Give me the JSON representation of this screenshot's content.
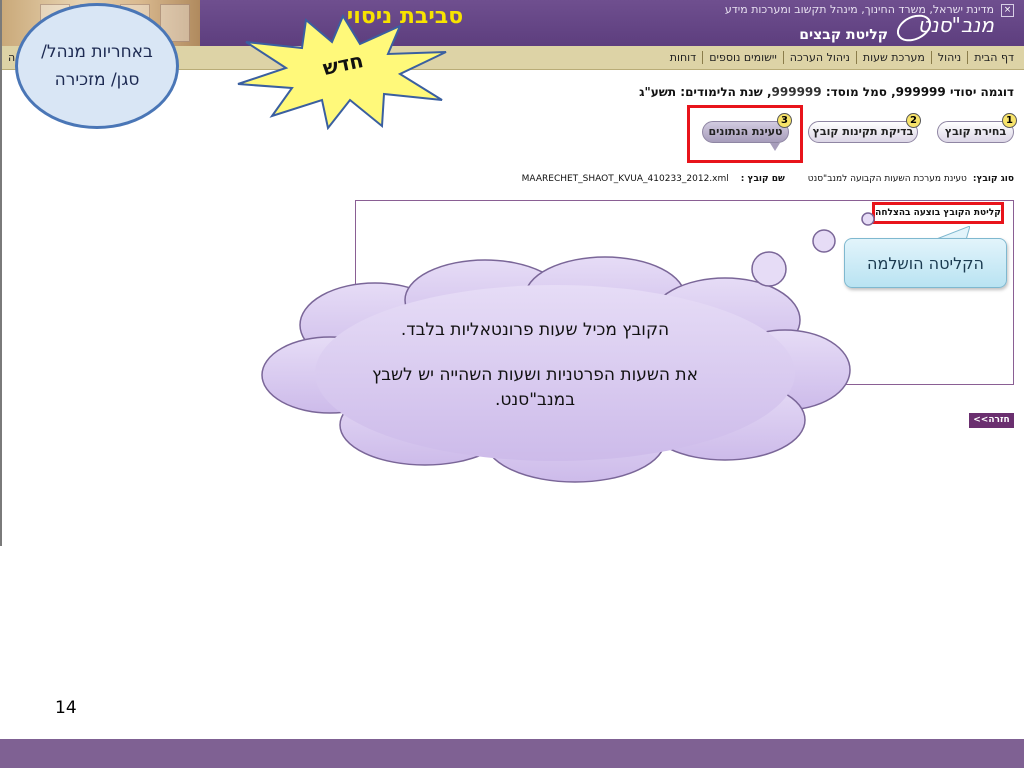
{
  "header": {
    "environment_title": "סביבת ניסוי",
    "ministry_line": "מדינת ישראל, משרד החינוך, מינהל תקשוב ומערכות מידע",
    "brand_name": "מנב\"סנט",
    "page_heading": "קליטת קבצים"
  },
  "menu": {
    "items": [
      "דף הבית",
      "ניהול",
      "מערכת שעות",
      "ניהול הערכה",
      "יישומים נוספים",
      "דוחות"
    ],
    "left_stub": "ה"
  },
  "school": {
    "name_label": "דוגמה יסודי",
    "name_code": "999999",
    "institution_label": "סמל מוסד:",
    "institution_code": "999999",
    "year_label": "שנת הלימודים:",
    "year_value": "תשע\"ג"
  },
  "steps": [
    {
      "num": "1",
      "label": "בחירת קובץ"
    },
    {
      "num": "2",
      "label": "בדיקת תקינות קובץ"
    },
    {
      "num": "3",
      "label": "טעינת הנתונים"
    }
  ],
  "file_info": {
    "type_label": "סוג קובץ:",
    "type_value": "טעינת מערכת השעות הקבועה למנב\"סנט",
    "name_label": "שם קובץ :",
    "name_value": "MAARECHET_SHAOT_KVUA_410233_2012.xml"
  },
  "result": {
    "success_message": "קליטת הקובץ בוצעה בהצלחה"
  },
  "back_button": "<<חזרה",
  "overlays": {
    "responsibility_text": "באחריות מנהל/ סגן/ מזכירה",
    "new_badge": "חדש",
    "complete_callout": "הקליטה הושלמה",
    "cloud_line1": "הקובץ מכיל שעות פרונטאליות בלבד.",
    "cloud_line2": "את השעות הפרטניות ושעות השהייה יש לשבץ במנב\"סנט."
  },
  "slide_number": "14",
  "colors": {
    "header_purple": "#5d3e7e",
    "menu_beige": "#ddd3a6",
    "highlight_red": "#e8141b",
    "cloud_fill": "#d6c8ee",
    "footer_purple": "#7f6193"
  }
}
